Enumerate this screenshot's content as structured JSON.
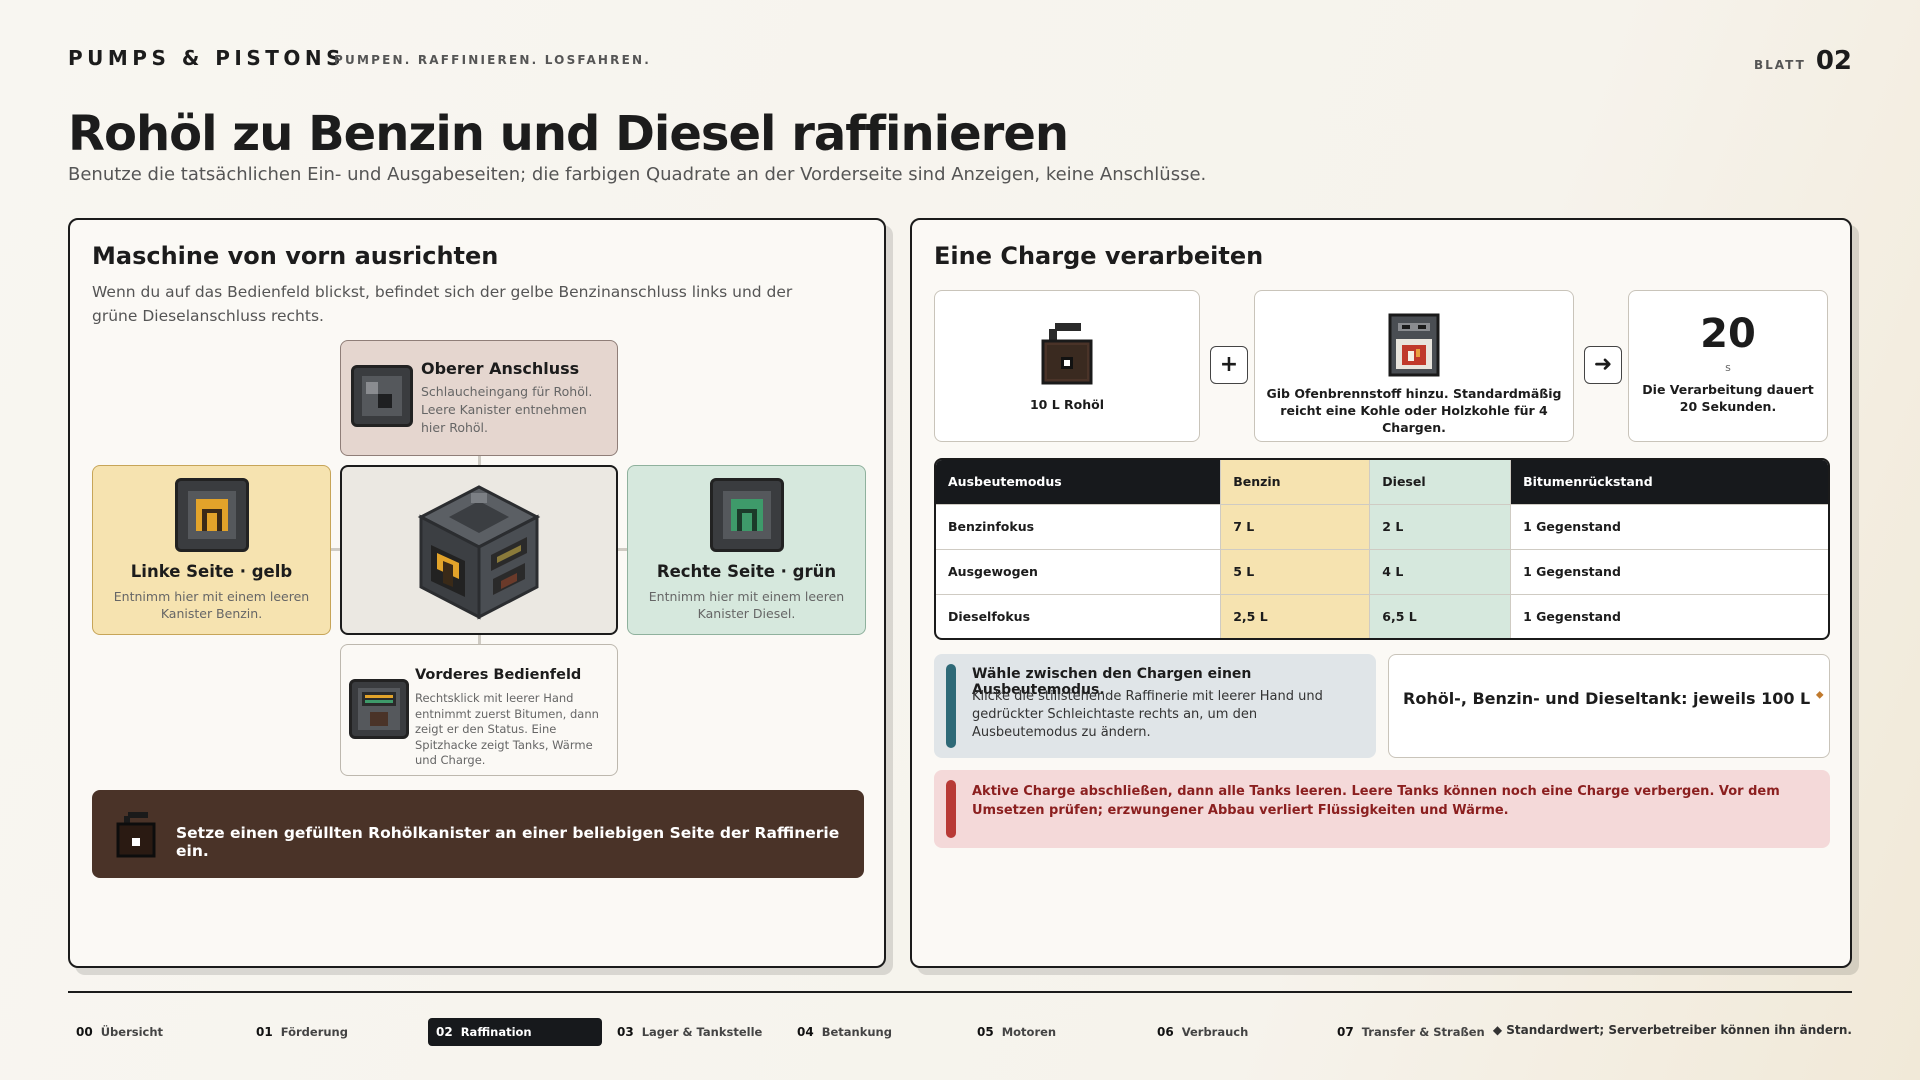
{
  "header": {
    "brand": "PUMPS & PISTONS",
    "tagline": "PUMPEN. RAFFINIEREN. LOSFAHREN.",
    "sheet_label": "BLATT",
    "sheet_number": "02"
  },
  "title": "Rohöl zu Benzin und Diesel raffinieren",
  "subtitle": "Benutze die tatsächlichen Ein- und Ausgabeseiten; die farbigen Quadrate an der Vorderseite sind Anzeigen, keine Anschlüsse.",
  "left_panel": {
    "heading": "Maschine von vorn ausrichten",
    "description": "Wenn du auf das Bedienfeld blickst, befindet sich der gelbe Benzinanschluss links und der grüne Dieselanschluss rechts.",
    "top_port": {
      "name": "Oberer Anschluss",
      "text": "Schlaucheingang für Rohöl. Leere Kanister entnehmen hier Rohöl."
    },
    "left_port": {
      "name": "Linke Seite · gelb",
      "text": "Entnimm hier mit einem leeren Kanister Benzin."
    },
    "right_port": {
      "name": "Rechte Seite · grün",
      "text": "Entnimm hier mit einem leeren Kanister Diesel."
    },
    "front_panel": {
      "name": "Vorderes Bedienfeld",
      "text": "Rechtsklick mit leerer Hand entnimmt zuerst Bitumen, dann zeigt er den Status. Eine Spitzhacke zeigt Tanks, Wärme und Charge."
    },
    "banner": "Setze einen gefüllten Rohölkanister an einer beliebigen Seite der Raffinerie ein."
  },
  "right_panel": {
    "heading": "Eine Charge verarbeiten",
    "input_label": "10 L Rohöl",
    "plus": "+",
    "fuel_label": "Gib Ofenbrennstoff hinzu. Standardmäßig reicht eine Kohle oder Holzkohle für 4 Chargen.",
    "arrow": "➜",
    "time_value": "20",
    "time_unit": "s",
    "time_label": "Die Verarbeitung dauert 20 Sekunden.",
    "table": {
      "headers": [
        "Ausbeutemodus",
        "Benzin",
        "Diesel",
        "Bitumenrückstand"
      ],
      "rows": [
        [
          "Benzinfokus",
          "7 L",
          "2 L",
          "1 Gegenstand"
        ],
        [
          "Ausgewogen",
          "5 L",
          "4 L",
          "1 Gegenstand"
        ],
        [
          "Dieselfokus",
          "2,5 L",
          "6,5 L",
          "1 Gegenstand"
        ]
      ]
    },
    "mode_note_head": "Wähle zwischen den Chargen einen Ausbeutemodus.",
    "mode_note_text": "Klicke die stillstehende Raffinerie mit leerer Hand und gedrückter Schleichtaste rechts an, um den Ausbeutemodus zu ändern.",
    "tank_note": "Rohöl-, Benzin- und Dieseltank: jeweils 100 L",
    "tank_note_mark": "◆",
    "warning": "Aktive Charge abschließen, dann alle Tanks leeren. Leere Tanks können noch eine Charge verbergen. Vor dem Umsetzen prüfen; erzwungener Abbau verliert Flüssigkeiten und Wärme."
  },
  "nav": [
    {
      "num": "00",
      "label": "Übersicht"
    },
    {
      "num": "01",
      "label": "Förderung"
    },
    {
      "num": "02",
      "label": "Raffination"
    },
    {
      "num": "03",
      "label": "Lager & Tankstelle"
    },
    {
      "num": "04",
      "label": "Betankung"
    },
    {
      "num": "05",
      "label": "Motoren"
    },
    {
      "num": "06",
      "label": "Verbrauch"
    },
    {
      "num": "07",
      "label": "Transfer & Straßen"
    }
  ],
  "footnote": "◆ Standardwert; Serverbetreiber können ihn ändern.",
  "colors": {
    "benzin": "#f6e3b0",
    "diesel": "#d6e8dd",
    "dark": "#17191c",
    "banner": "#4a3328",
    "info_bar": "#2e6977",
    "warn_bar": "#b83a36"
  }
}
